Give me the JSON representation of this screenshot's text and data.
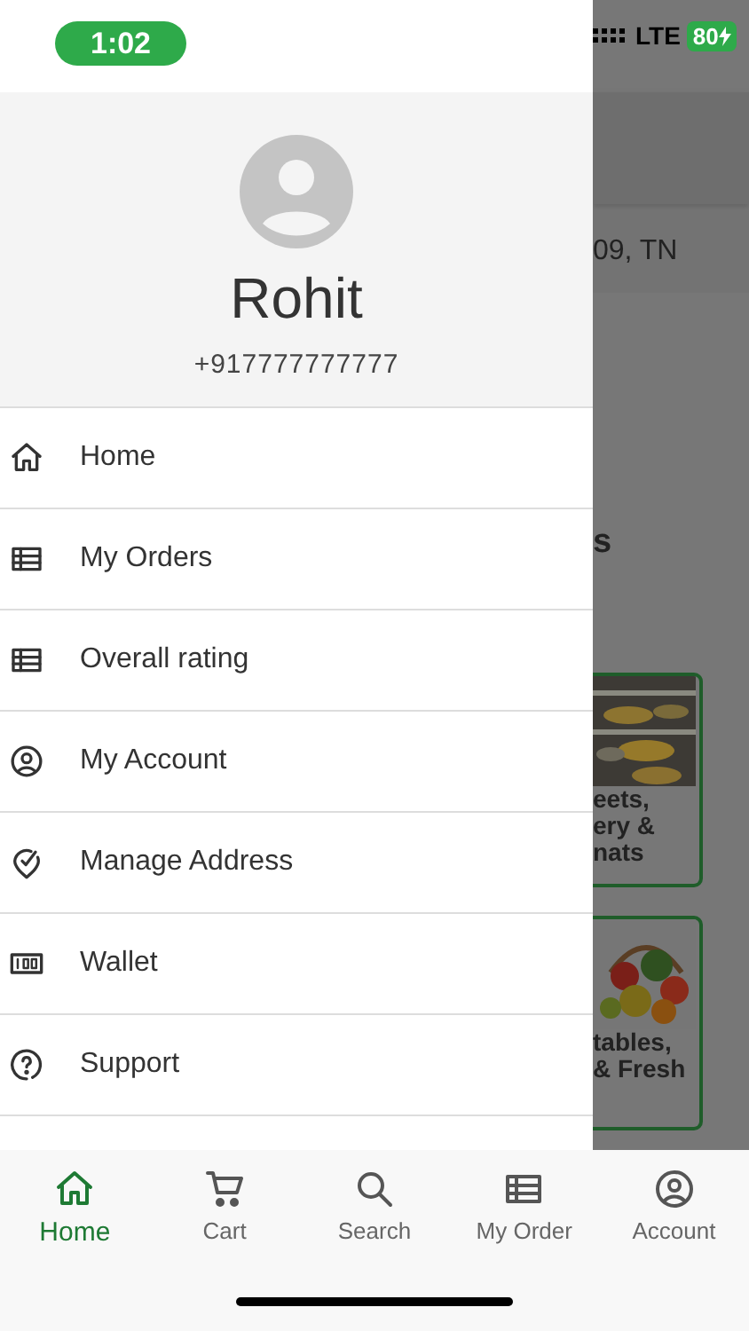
{
  "status_bar": {
    "time": "1:02",
    "network": "LTE",
    "battery": "80"
  },
  "profile": {
    "name": "Rohit",
    "phone": "+917777777777"
  },
  "menu": [
    {
      "label": "Home"
    },
    {
      "label": "My Orders"
    },
    {
      "label": "Overall rating"
    },
    {
      "label": "My Account"
    },
    {
      "label": "Manage Address"
    },
    {
      "label": "Wallet"
    },
    {
      "label": "Support"
    }
  ],
  "background_page": {
    "address": "09, TN",
    "heading": "s",
    "cards": [
      {
        "lines": [
          "eets,",
          "ery &",
          "nats"
        ]
      },
      {
        "lines": [
          "tables,",
          "& Fresh"
        ]
      }
    ]
  },
  "bottom_nav": [
    {
      "label": "Home",
      "selected": true
    },
    {
      "label": "Cart",
      "selected": false
    },
    {
      "label": "Search",
      "selected": false
    },
    {
      "label": "My Order",
      "selected": false
    },
    {
      "label": "Account",
      "selected": false
    }
  ]
}
